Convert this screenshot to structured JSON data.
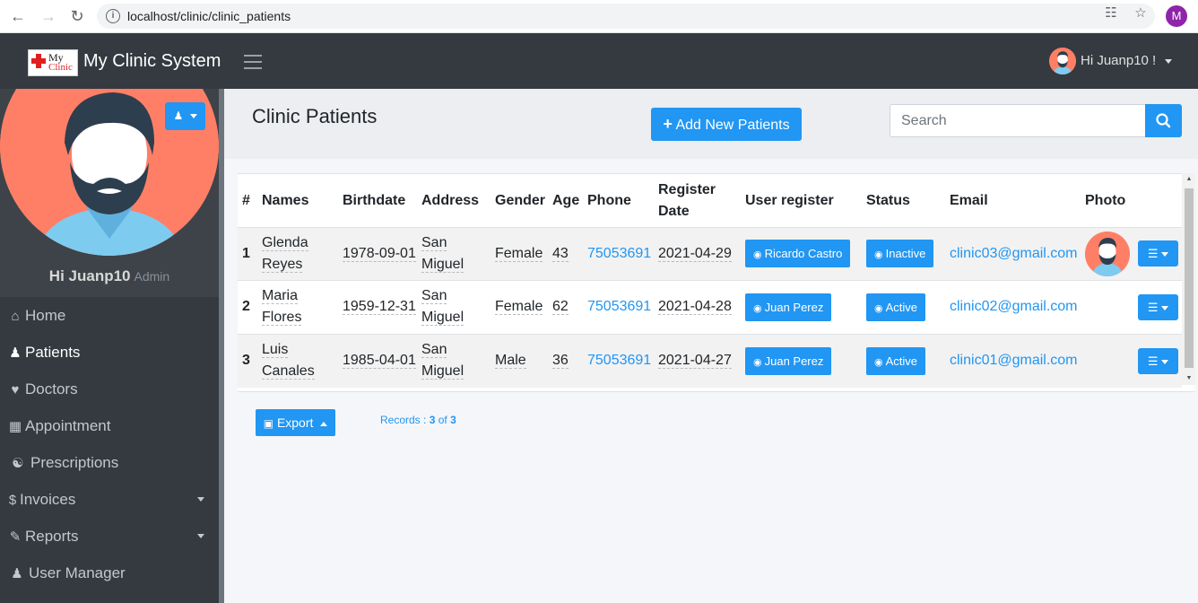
{
  "browser": {
    "url": "localhost/clinic/clinic_patients",
    "profile_initial": "M"
  },
  "navbar": {
    "logo_line1": "My",
    "logo_line2": "Clinic",
    "brand": "My Clinic System",
    "user_greeting": "Hi Juanp10 !"
  },
  "sidebar": {
    "greeting": "Hi Juanp10",
    "role": "Admin",
    "items": [
      {
        "label": "Home",
        "icon": "home-icon"
      },
      {
        "label": "Patients",
        "icon": "user-plus-icon"
      },
      {
        "label": "Doctors",
        "icon": "heartbeat-icon"
      },
      {
        "label": "Appointment",
        "icon": "calendar-icon"
      },
      {
        "label": "Prescriptions",
        "icon": "pills-icon"
      },
      {
        "label": "Invoices",
        "icon": "dollar-icon"
      },
      {
        "label": "Reports",
        "icon": "edit-icon"
      },
      {
        "label": "User Manager",
        "icon": "users-icon"
      }
    ]
  },
  "header": {
    "title": "Clinic Patients",
    "add_button": "Add New Patients",
    "search_placeholder": "Search"
  },
  "table": {
    "columns": [
      "#",
      "Names",
      "Birthdate",
      "Address",
      "Gender",
      "Age",
      "Phone",
      "Register Date",
      "User register",
      "Status",
      "Email",
      "Photo"
    ],
    "rows": [
      {
        "num": "1",
        "name": "Glenda Reyes",
        "birthdate": "1978-09-01",
        "address": "San Miguel",
        "gender": "Female",
        "age": "43",
        "phone": "75053691",
        "register_date": "2021-04-29",
        "user_register": "Ricardo Castro",
        "status": "Inactive",
        "email": "clinic03@gmail.com",
        "has_photo": true
      },
      {
        "num": "2",
        "name": "Maria Flores",
        "birthdate": "1959-12-31",
        "address": "San Miguel",
        "gender": "Female",
        "age": "62",
        "phone": "75053691",
        "register_date": "2021-04-28",
        "user_register": "Juan Perez",
        "status": "Active",
        "email": "clinic02@gmail.com",
        "has_photo": false
      },
      {
        "num": "3",
        "name": "Luis Canales",
        "birthdate": "1985-04-01",
        "address": "San Miguel",
        "gender": "Male",
        "age": "36",
        "phone": "75053691",
        "register_date": "2021-04-27",
        "user_register": "Juan Perez",
        "status": "Active",
        "email": "clinic01@gmail.com",
        "has_photo": false
      }
    ]
  },
  "footer": {
    "export_label": "Export",
    "records_prefix": "Records :",
    "records_shown": "3",
    "records_of": "of",
    "records_total": "3"
  },
  "colors": {
    "accent": "#2196f3",
    "sidebar_bg": "#343a40",
    "avatar_bg": "#ff7f66"
  }
}
